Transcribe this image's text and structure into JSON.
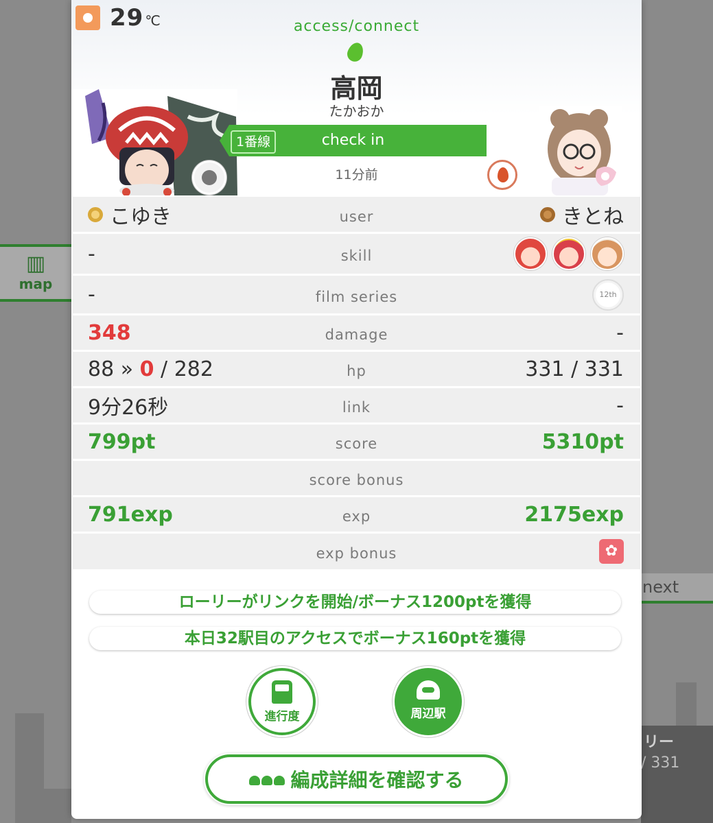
{
  "weather": {
    "icon": "sun-icon",
    "temperature": "29",
    "unit": "℃"
  },
  "side": {
    "map_label": "map",
    "next_label": "next",
    "right_name": "リー",
    "right_hp": "/ 331"
  },
  "header": {
    "mode": "access/connect",
    "station_name": "高岡",
    "station_kana": "たかおか",
    "line_badge": "1番線",
    "checkin_label": "check in",
    "time_ago": "11分前"
  },
  "table": {
    "user": {
      "label": "user",
      "left": "こゆき",
      "right": "きとね"
    },
    "skill": {
      "label": "skill",
      "left": "-"
    },
    "film": {
      "label": "film series",
      "left": "-",
      "badge": "12th"
    },
    "damage": {
      "label": "damage",
      "left": "348",
      "right": "-"
    },
    "hp": {
      "label": "hp",
      "left_before": "88 »",
      "left_after": "0",
      "left_max": "/ 282",
      "right": "331 / 331"
    },
    "link": {
      "label": "link",
      "left": "9分26秒",
      "right": "-"
    },
    "score": {
      "label": "score",
      "left": "799pt",
      "right": "5310pt"
    },
    "score_bonus": {
      "label": "score bonus"
    },
    "exp": {
      "label": "exp",
      "left": "791exp",
      "right": "2175exp"
    },
    "exp_bonus": {
      "label": "exp bonus"
    }
  },
  "messages": [
    "ローリーがリンクを開始/ボーナス1200ptを獲得",
    "本日32駅目のアクセスでボーナス160ptを獲得"
  ],
  "buttons": {
    "progress": "進行度",
    "nearby": "周辺駅",
    "team_detail": "編成詳細を確認する"
  },
  "colors": {
    "accent": "#3fa93a",
    "damage": "#e23b3b",
    "text": "#333333"
  }
}
